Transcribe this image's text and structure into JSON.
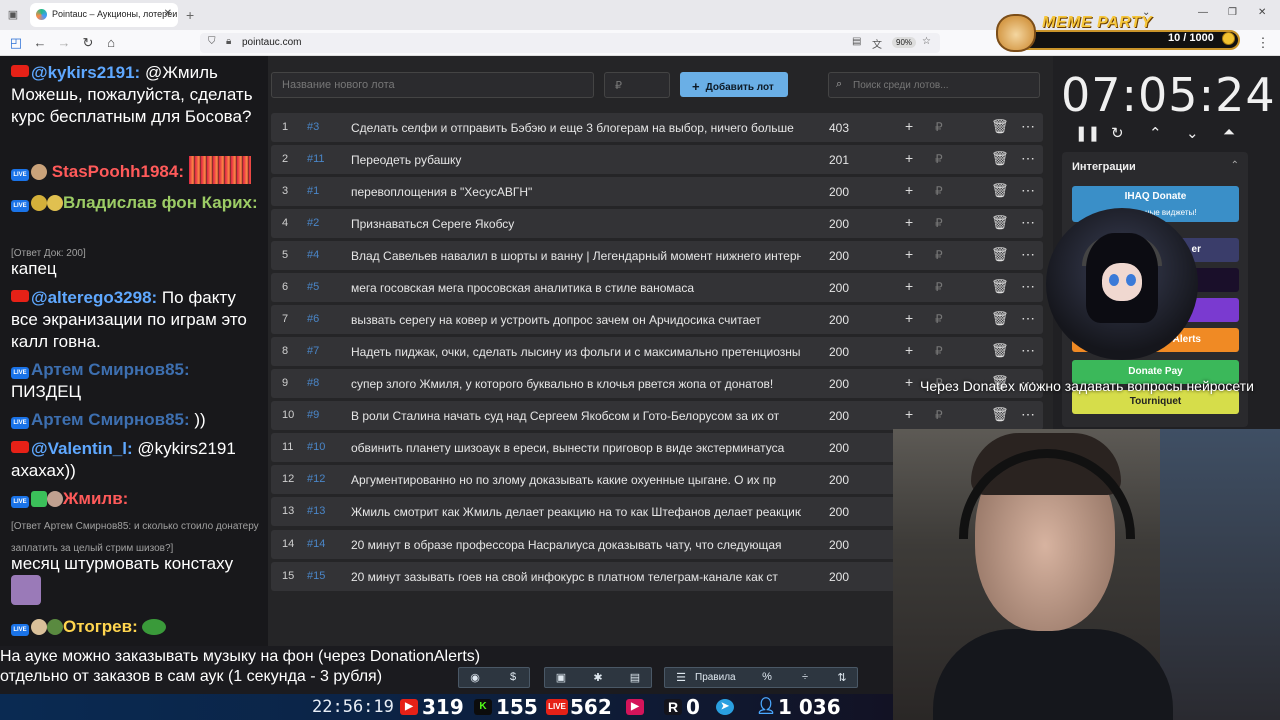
{
  "browser": {
    "tab_title": "Pointauc – Аукционы, лотереи",
    "url": "pointauc.com",
    "zoom": "90%"
  },
  "chat": [
    {
      "nick": "@kykirs2191:",
      "nick_color": "#5fa8ff",
      "text": " @Жмиль Можешь, пожалуйста, сделать курс бесплатным для Босова?"
    },
    {
      "nick": "StasPoohh1984:",
      "nick_color": "#ff5a5a",
      "text": ""
    },
    {
      "nick": "Владислав фон Карих:",
      "nick_color": "#9ccc65",
      "text": ""
    },
    {
      "meta": "[Ответ Док: 200]"
    },
    {
      "text": "капец"
    },
    {
      "nick": "@alterego3298:",
      "nick_color": "#5fa8ff",
      "text": " По факту все экранизации по играм это калл говна."
    },
    {
      "nick": "Артем Смирнов85:",
      "nick_color": "#3d6fb0",
      "text": ""
    },
    {
      "text": "ПИЗДЕЦ"
    },
    {
      "nick": "Артем Смирнов85:",
      "nick_color": "#3d6fb0",
      "text": " ))"
    },
    {
      "nick": "@Valentin_l:",
      "nick_color": "#5fa8ff",
      "text": " @kykirs2191 ахахах))"
    },
    {
      "nick": "Жмилв:",
      "nick_color": "#ff5a5a",
      "text": ""
    },
    {
      "meta": "[Ответ Артем Смирнов85: и сколько стоило донатеру заплатить за целый стрим шизов?]"
    },
    {
      "text": "месяц штурмовать констаху"
    },
    {
      "nick": "Отогрев:",
      "nick_color": "#ffd54f",
      "text": ""
    }
  ],
  "form": {
    "lot_placeholder": "Название нового лота",
    "price_placeholder": "₽",
    "add_label": "Добавить лот",
    "search_placeholder": "Поиск среди лотов..."
  },
  "lots": [
    {
      "n": "1",
      "id": "#3",
      "name": "Сделать селфи и отправить Бэбэю и еще 3 блогерам на выбор, ничего больше",
      "amount": "403"
    },
    {
      "n": "2",
      "id": "#11",
      "name": "Переодеть рубашку",
      "amount": "201"
    },
    {
      "n": "3",
      "id": "#1",
      "name": "перевоплощения в \"ХесусАВГН\"",
      "amount": "200"
    },
    {
      "n": "4",
      "id": "#2",
      "name": "Признаваться Сереге Якобсу",
      "amount": "200"
    },
    {
      "n": "5",
      "id": "#4",
      "name": "Влад Савельев навалил в шорты и ванну | Легендарный момент нижнего интернета",
      "amount": "200"
    },
    {
      "n": "6",
      "id": "#5",
      "name": "мега госовская мега просовская аналитика в стиле ваномаса",
      "amount": "200"
    },
    {
      "n": "7",
      "id": "#6",
      "name": "вызвать серегу на ковер и устроить допрос зачем он Арчидосика считает",
      "amount": "200"
    },
    {
      "n": "8",
      "id": "#7",
      "name": "Надеть пиджак, очки, сделать лысину из фольги и с максимально претенциозным",
      "amount": "200"
    },
    {
      "n": "9",
      "id": "#8",
      "name": "супер злого Жмиля, у которого буквально в клочья рвется жопа от донатов!",
      "amount": "200"
    },
    {
      "n": "10",
      "id": "#9",
      "name": "В роли Сталина начать суд над Сергеем Якобсом и Гото-Белорусом за их от",
      "amount": "200"
    },
    {
      "n": "11",
      "id": "#10",
      "name": "обвинить планету шизоаук в ереси, вынести приговор в виде экстерминатуса",
      "amount": "200"
    },
    {
      "n": "12",
      "id": "#12",
      "name": "Аргументированно но по злому доказывать какие охуенные цыгане. О их пр",
      "amount": "200"
    },
    {
      "n": "13",
      "id": "#13",
      "name": "Жмиль смотрит как Жмиль делает реакцию на то как Штефанов делает реакцию",
      "amount": "200"
    },
    {
      "n": "14",
      "id": "#14",
      "name": "20 минут в образе профессора Насралиуса доказывать чату, что следующая",
      "amount": "200"
    },
    {
      "n": "15",
      "id": "#15",
      "name": "20 минут зазывать гоев на свой инфокурс в платном телеграм-канале как ст",
      "amount": "200"
    }
  ],
  "timer": {
    "value": "07:05:24"
  },
  "integrations": {
    "title": "Интеграции",
    "ihaq_label": "IHAQ Donate",
    "ihaq_sub": "Уникальные виджеты!",
    "alerts_label": "Alerts",
    "donatepay_label": "Donate Pay",
    "tourniquet_label": "Tourniquet",
    "partial_label": "er"
  },
  "overlay": {
    "donatex_note": "Через Donatex можно задавать вопросы нейросети",
    "music_line1": "На ауке можно заказывать музыку на фон (через DonationAlerts)",
    "music_line2": "отдельно от заказов в сам аук (1 секунда - 3 рубля)",
    "rules_label": "Правила"
  },
  "meme_party": {
    "title": "MEME PARTY",
    "progress": "10 / 1000"
  },
  "stats": {
    "clock": "22:56:19",
    "youtube": "319",
    "kick": "155",
    "live": "562",
    "rutube": "0",
    "total": "1 036"
  }
}
